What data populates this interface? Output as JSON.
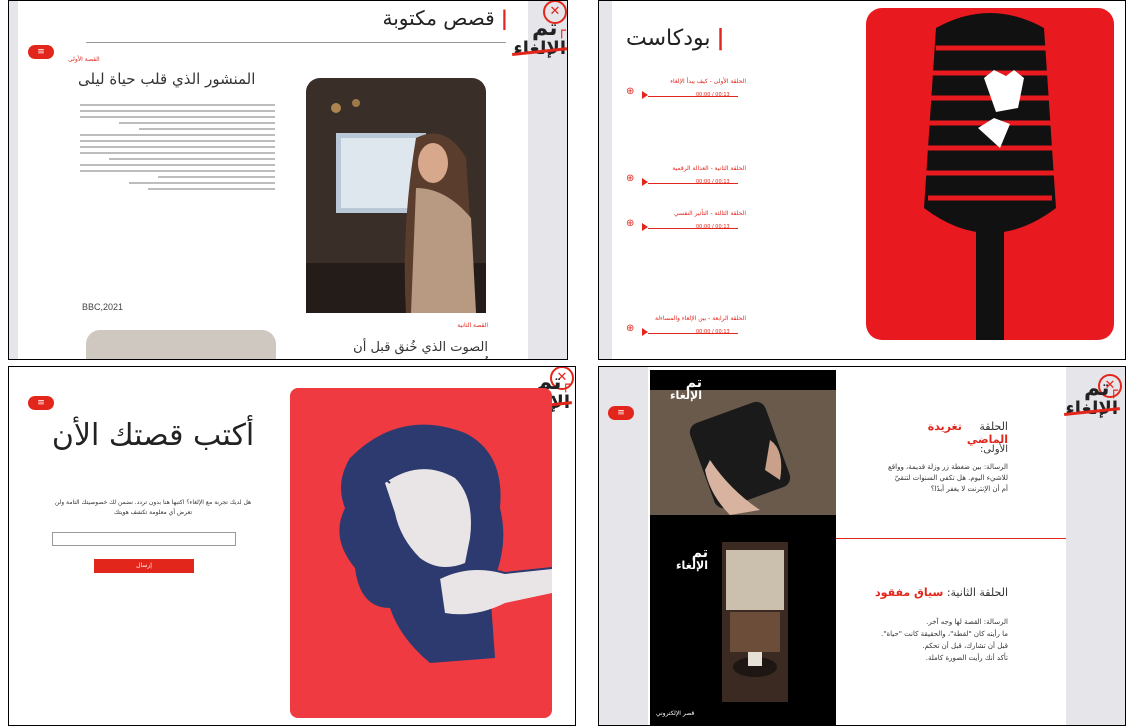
{
  "logo": {
    "line1": "تم",
    "line2": "الإلغاء"
  },
  "menu_label": "≡",
  "stories": {
    "section_title": "قصص مكتوبة",
    "story1": {
      "tag": "القصة الأولى",
      "title": "المنشور الذي قلب حياة ليلى",
      "source": "BBC,2021"
    },
    "story2": {
      "tag": "القصة الثانية",
      "title": "الصوت الذي خُنق قبل أن يُسمع"
    }
  },
  "podcast": {
    "section_title": "بودكاست",
    "episodes": [
      {
        "title": "الحلقة الأولى - كيف يبدأ الإلغاء",
        "time": "00:00 / 00:13"
      },
      {
        "title": "الحلقة الثانية - العدالة الرقمية",
        "time": "00:00 / 00:13"
      },
      {
        "title": "الحلقة الثالثة - التأثير النفسي",
        "time": "00:00 / 00:13"
      },
      {
        "title": "الحلقة الرابعة - بين الإلغاء والمساءلة",
        "time": "00:00 / 00:13"
      }
    ]
  },
  "write": {
    "title": "أكتب قصتك الأن",
    "description": "هل لديك تجربة مع الإلغاء؟ اكتبها هنا بدون تردد. نضمن لك خصوصيتك التامة ولن تعرض أي معلومة تكشف هويتك",
    "input_placeholder": "",
    "submit_label": "إرسال"
  },
  "episodes": {
    "ep1_label": "الحلقة",
    "ep1_name": "تغريدة الماضي",
    "ep1_sub": "الأولى:",
    "ep1_body": "الرسالة: بين ضغطة زر وزلة قديمة، وواقع للاشيء اليوم. هل تكفي السنوات لتنقيّ أم أن الإنترنت لا يغفر أبدًا؟",
    "ep2_label": "الحلقة الثانية:",
    "ep2_name": "سياق مفقود",
    "ep2_body_1": "الرسالة: القصة لها وجه آخر.",
    "ep2_body_2": "ما رأيته كان \"لقطة\"، والحقيقة كانت \"حياة\".",
    "ep2_body_3": "قبل أن تشارك، قبل أن تحكم.",
    "ep2_body_4": "تأكد أنك رأيت الصورة كاملة.",
    "video_caption": "قصر الإلكتروني"
  },
  "colors": {
    "accent": "#e3261b",
    "poster_red": "#ee3a40",
    "ink": "#222222",
    "blue_print": "#2d3a6f"
  }
}
